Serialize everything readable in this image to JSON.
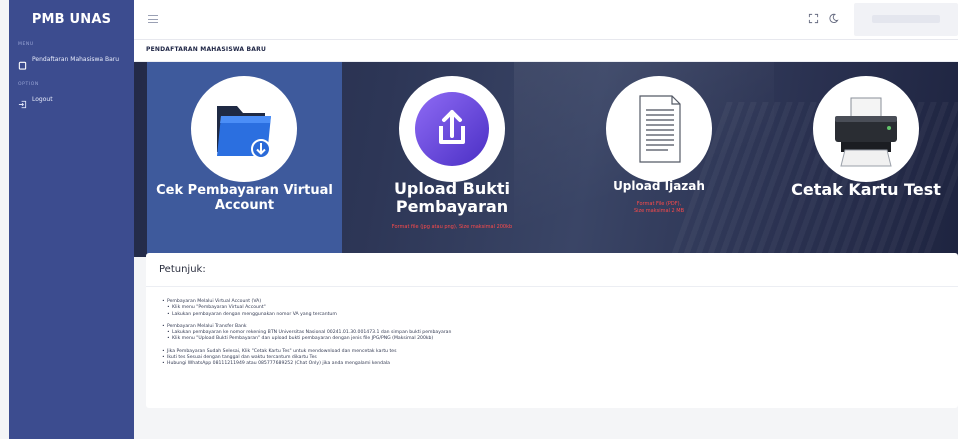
{
  "app": {
    "title": "PMB UNAS"
  },
  "sidebar": {
    "menu_caption": "MENU",
    "option_caption": "OPTION",
    "items": [
      {
        "label": "Pendaftaran Mahasiswa Baru",
        "icon": "clipboard-icon"
      },
      {
        "label": "Logout",
        "icon": "logout-icon"
      }
    ]
  },
  "topbar": {
    "menu_icon": "hamburger-icon",
    "fullscreen_icon": "fullscreen-icon",
    "theme_icon": "moon-icon"
  },
  "page": {
    "title": "PENDAFTARAN MAHASISWA BARU"
  },
  "cards": [
    {
      "title": "Cek Pembayaran Virtual Account",
      "subtitle": "",
      "icon": "folder-download-icon"
    },
    {
      "title": "Upload Bukti Pembayaran",
      "subtitle": "Format file (jpg atau png), Size maksimal 200kb",
      "icon": "upload-icon"
    },
    {
      "title": "Upload Ijazah",
      "subtitle_line1": "Format File (PDF),",
      "subtitle_line2": "Size maksimal 2 MB",
      "icon": "document-icon"
    },
    {
      "title": "Cetak Kartu Test",
      "subtitle": "",
      "icon": "printer-icon"
    }
  ],
  "petunjuk": {
    "title": "Petunjuk:",
    "groups": [
      {
        "heading": "Pembayaran Melalui Virtual Account (VA)",
        "items": [
          "Klik menu \"Pembayaran Virtual Account\"",
          "Lakukan pembayaran dengan menggunakan nomor VA yang tercantum"
        ]
      },
      {
        "heading": "Pembayaran Melalui Transfer Bank",
        "items": [
          "Lakukan pembayaran ke nomor rekening BTN Universitas Nasional 00241.01.30.001473.1 dan simpan bukti pembayaran",
          "Klik menu \"Upload Bukti Pembayaran\" dan upload bukti pembayaran dengan jenis file JPG/PNG (Maksimal 200kb)"
        ]
      }
    ],
    "final_items": [
      "Jika Pembayaran Sudah Selesai, Klik \"Cetak Kartu Tes\" untuk mendownload dan mencetak kartu tes",
      "Ikuti tes Sesuai dengan tanggal dan waktu tercantum dikartu Tes",
      "Hubungi WhatsApp 08111211949 atau 085777689252 (Chat Only) jika anda mengalami kendala"
    ]
  },
  "colors": {
    "sidebar": "#3c4c8f",
    "active_card": "#3e5a9c",
    "hero": "#2d3656",
    "note_red": "#ff4a4a"
  }
}
